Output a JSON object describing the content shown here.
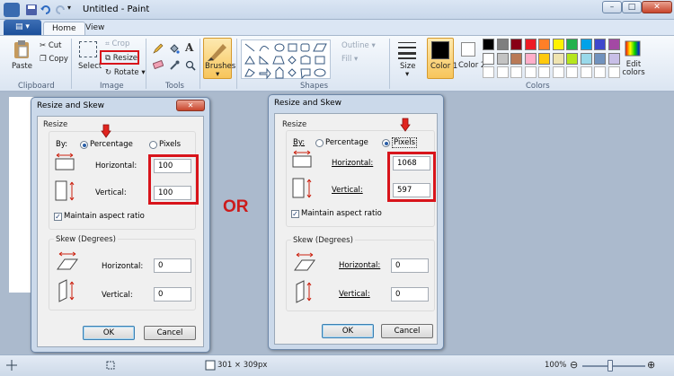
{
  "window": {
    "title": "Untitled - Paint",
    "minimize": "–",
    "maximize": "□",
    "close": "✕"
  },
  "tabs": {
    "menu": "▤ ▾",
    "home": "Home",
    "view": "View"
  },
  "ribbon": {
    "clipboard": {
      "paste": "Paste",
      "cut": "Cut",
      "copy": "Copy",
      "label": "Clipboard"
    },
    "image": {
      "select": "Select",
      "crop": "Crop",
      "resize": "Resize",
      "rotate": "Rotate",
      "label": "Image"
    },
    "tools": {
      "label": "Tools",
      "text_tool": "A"
    },
    "brushes": {
      "label": "Brushes"
    },
    "shapes": {
      "outline": "Outline",
      "fill": "Fill",
      "label": "Shapes"
    },
    "size": {
      "label": "Size"
    },
    "colors": {
      "color1": "Color 1",
      "color2": "Color 2",
      "edit": "Edit colors",
      "label": "Colors",
      "row1": [
        "#000000",
        "#7f7f7f",
        "#880015",
        "#ed1c24",
        "#ff7f27",
        "#fff200",
        "#22b14c",
        "#00a2e8",
        "#3f48cc",
        "#a349a4"
      ],
      "row2": [
        "#ffffff",
        "#c3c3c3",
        "#b97a57",
        "#ffaec9",
        "#ffc90e",
        "#efe4b0",
        "#b5e61d",
        "#99d9ea",
        "#7092be",
        "#c8bfe7"
      ],
      "row3": [
        "#ffffff",
        "#ffffff",
        "#ffffff",
        "#ffffff",
        "#ffffff",
        "#ffffff",
        "#ffffff",
        "#ffffff",
        "#ffffff",
        "#ffffff"
      ]
    }
  },
  "dialog_percent": {
    "title": "Resize and Skew",
    "resize_label": "Resize",
    "by": "By:",
    "percentage": "Percentage",
    "pixels": "Pixels",
    "horizontal": "Horizontal:",
    "vertical": "Vertical:",
    "h_value": "100",
    "v_value": "100",
    "maintain": "Maintain aspect ratio",
    "skew_label": "Skew (Degrees)",
    "skew_h": "0",
    "skew_v": "0",
    "ok": "OK",
    "cancel": "Cancel"
  },
  "dialog_pixels": {
    "title": "Resize and Skew",
    "resize_label": "Resize",
    "by": "By:",
    "percentage": "Percentage",
    "pixels": "Pixels",
    "horizontal": "Horizontal:",
    "vertical": "Vertical:",
    "h_value": "1068",
    "v_value": "597",
    "maintain": "Maintain aspect ratio",
    "skew_label": "Skew (Degrees)",
    "skew_h": "0",
    "skew_v": "0",
    "ok": "OK",
    "cancel": "Cancel"
  },
  "annotation": {
    "or": "OR",
    "highlight_color": "#d8141b"
  },
  "status": {
    "dimensions": "301 × 309px",
    "zoom": "100%",
    "minus": "⊖",
    "plus": "⊕"
  }
}
